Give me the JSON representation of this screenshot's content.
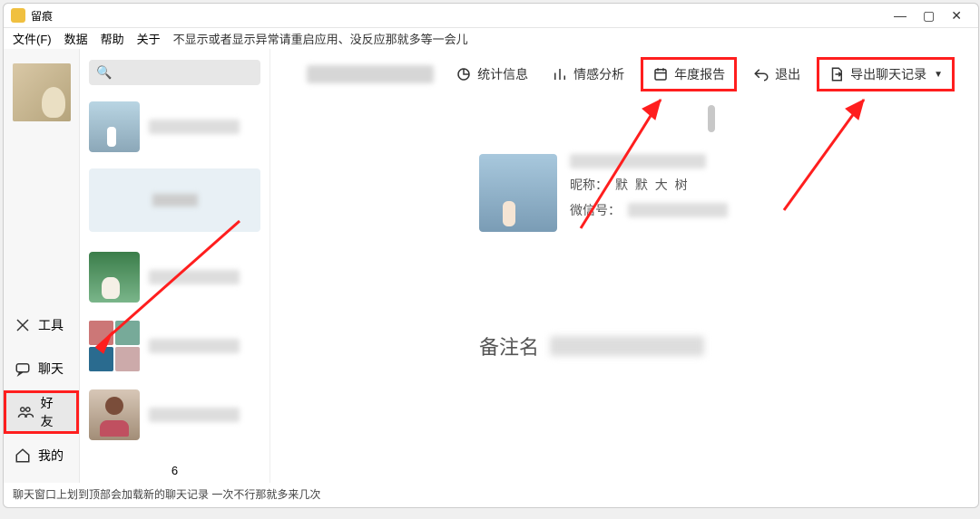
{
  "window": {
    "title": "留痕"
  },
  "menu": {
    "file": "文件(F)",
    "data": "数据",
    "help": "帮助",
    "about": "关于",
    "hint": "不显示或者显示异常请重启应用、没反应那就多等一会儿"
  },
  "sidebar": {
    "tools": "工具",
    "chat": "聊天",
    "friends": "好友",
    "mine": "我的"
  },
  "search": {
    "placeholder": ""
  },
  "toolbar": {
    "stats": "统计信息",
    "sentiment": "情感分析",
    "annual": "年度报告",
    "exit": "退出",
    "export": "导出聊天记录"
  },
  "profile": {
    "nick_label": "昵称：",
    "nick_value": "默  默  大  树",
    "wxid_label": "微信号：",
    "remark_label": "备注名"
  },
  "pager": {
    "page": "6"
  },
  "footer": {
    "hint": "聊天窗口上划到顶部会加载新的聊天记录 一次不行那就多来几次"
  }
}
